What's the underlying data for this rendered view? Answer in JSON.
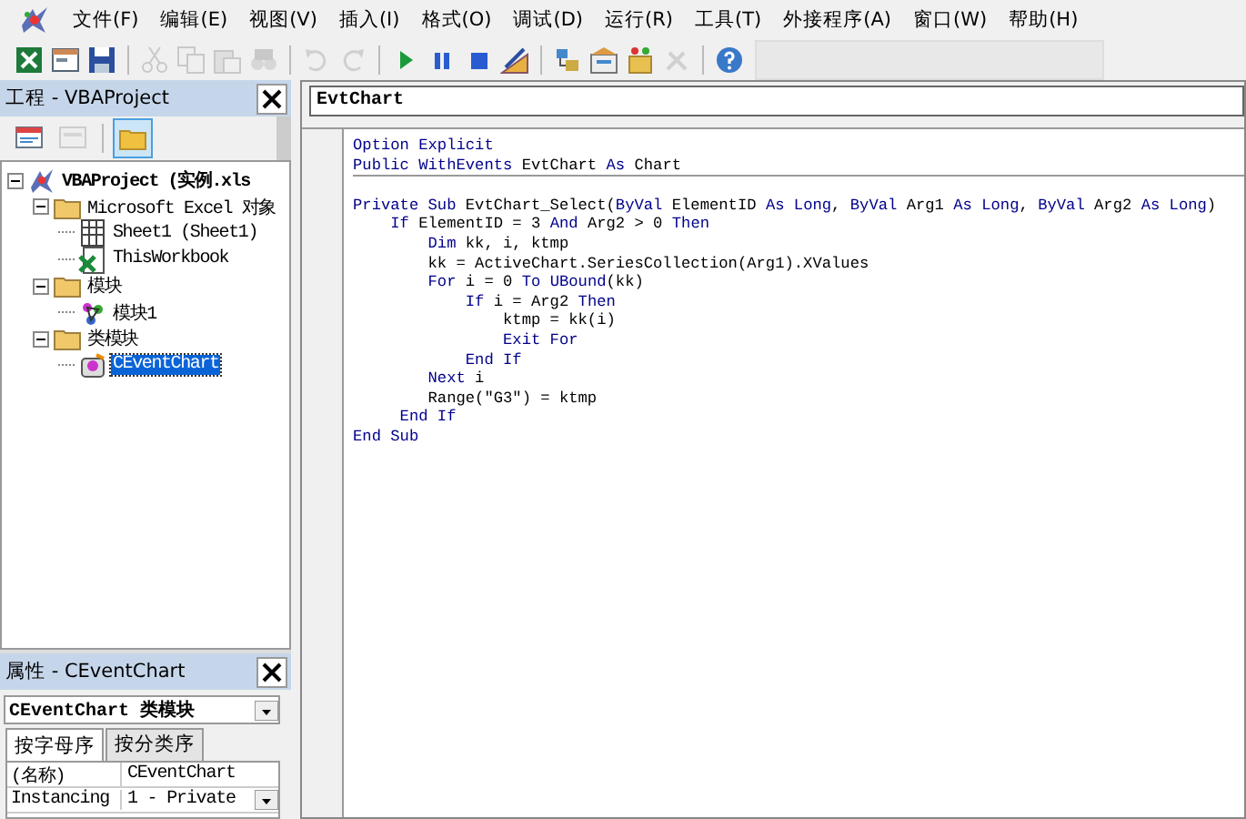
{
  "menu": [
    {
      "label": "文件(F)"
    },
    {
      "label": "编辑(E)"
    },
    {
      "label": "视图(V)"
    },
    {
      "label": "插入(I)"
    },
    {
      "label": "格式(O)"
    },
    {
      "label": "调试(D)"
    },
    {
      "label": "运行(R)"
    },
    {
      "label": "工具(T)"
    },
    {
      "label": "外接程序(A)"
    },
    {
      "label": "窗口(W)"
    },
    {
      "label": "帮助(H)"
    }
  ],
  "toolbar": [
    {
      "kind": "excel",
      "disabled": false
    },
    {
      "kind": "insert",
      "disabled": false
    },
    {
      "kind": "save",
      "disabled": false
    },
    {
      "kind": "sep"
    },
    {
      "kind": "cut",
      "disabled": true
    },
    {
      "kind": "copy",
      "disabled": true
    },
    {
      "kind": "paste",
      "disabled": true
    },
    {
      "kind": "find",
      "disabled": true
    },
    {
      "kind": "sep"
    },
    {
      "kind": "undo",
      "disabled": true
    },
    {
      "kind": "redo",
      "disabled": true
    },
    {
      "kind": "sep"
    },
    {
      "kind": "run",
      "disabled": false
    },
    {
      "kind": "pause",
      "disabled": false
    },
    {
      "kind": "stop",
      "disabled": false
    },
    {
      "kind": "design",
      "disabled": false
    },
    {
      "kind": "sep"
    },
    {
      "kind": "project",
      "disabled": false
    },
    {
      "kind": "properties",
      "disabled": false
    },
    {
      "kind": "browser",
      "disabled": false
    },
    {
      "kind": "toolbox",
      "disabled": true
    },
    {
      "kind": "sep"
    },
    {
      "kind": "help",
      "disabled": false
    }
  ],
  "project_pane": {
    "title": "工程 - VBAProject",
    "tools": [
      {
        "kind": "code",
        "disabled": false,
        "selected": false
      },
      {
        "kind": "object",
        "disabled": true,
        "selected": false
      },
      {
        "kind": "folders",
        "disabled": false,
        "selected": true
      }
    ],
    "tree": [
      {
        "label": "VBAProject (实例.xls",
        "kind": "project",
        "expanded": true,
        "selected": false,
        "children": [
          {
            "label": "Microsoft Excel 对象",
            "kind": "folder",
            "expanded": true,
            "selected": false,
            "children": [
              {
                "label": "Sheet1 (Sheet1)",
                "kind": "sheet",
                "selected": false
              },
              {
                "label": "ThisWorkbook",
                "kind": "workbook",
                "selected": false
              }
            ]
          },
          {
            "label": "模块",
            "kind": "folder",
            "expanded": true,
            "selected": false,
            "children": [
              {
                "label": "模块1",
                "kind": "module",
                "selected": false
              }
            ]
          },
          {
            "label": "类模块",
            "kind": "folder",
            "expanded": true,
            "selected": false,
            "children": [
              {
                "label": "CEventChart",
                "kind": "class",
                "selected": true
              }
            ]
          }
        ]
      }
    ]
  },
  "properties_pane": {
    "title": "属性 - CEventChart",
    "object": "CEventChart 类模块",
    "tabs": [
      {
        "label": "按字母序",
        "selected": true
      },
      {
        "label": "按分类序",
        "selected": false
      }
    ],
    "rows": [
      {
        "name": "(名称)",
        "value": "CEventChart",
        "dropdown": false
      },
      {
        "name": "Instancing",
        "value": "1 - Private",
        "dropdown": true
      }
    ]
  },
  "code_window": {
    "object": "EvtChart",
    "sections": [
      {
        "lines": [
          [
            {
              "text": "Option Explicit",
              "kind": "keyword"
            }
          ],
          [
            {
              "text": "Public WithEvents",
              "kind": "keyword"
            },
            {
              "text": " EvtChart ",
              "kind": "plain"
            },
            {
              "text": "As",
              "kind": "keyword"
            },
            {
              "text": " Chart",
              "kind": "plain"
            }
          ]
        ]
      },
      {
        "lines": [
          [
            {
              "text": "Private Sub",
              "kind": "keyword"
            },
            {
              "text": " EvtChart_Select(",
              "kind": "plain"
            },
            {
              "text": "ByVal",
              "kind": "keyword"
            },
            {
              "text": " ElementID ",
              "kind": "plain"
            },
            {
              "text": "As Long",
              "kind": "keyword"
            },
            {
              "text": ", ",
              "kind": "plain"
            },
            {
              "text": "ByVal",
              "kind": "keyword"
            },
            {
              "text": " Arg1 ",
              "kind": "plain"
            },
            {
              "text": "As Long",
              "kind": "keyword"
            },
            {
              "text": ", ",
              "kind": "plain"
            },
            {
              "text": "ByVal",
              "kind": "keyword"
            },
            {
              "text": " Arg2 ",
              "kind": "plain"
            },
            {
              "text": "As Long",
              "kind": "keyword"
            },
            {
              "text": ")",
              "kind": "plain"
            }
          ],
          [
            {
              "text": "    If",
              "kind": "keyword"
            },
            {
              "text": " ElementID = 3 ",
              "kind": "plain"
            },
            {
              "text": "And",
              "kind": "keyword"
            },
            {
              "text": " Arg2 > 0 ",
              "kind": "plain"
            },
            {
              "text": "Then",
              "kind": "keyword"
            }
          ],
          [
            {
              "text": "        Dim",
              "kind": "keyword"
            },
            {
              "text": " kk, i, ktmp",
              "kind": "plain"
            }
          ],
          [
            {
              "text": "        kk = ActiveChart.SeriesCollection(Arg1).XValues",
              "kind": "plain"
            }
          ],
          [
            {
              "text": "        For",
              "kind": "keyword"
            },
            {
              "text": " i = 0 ",
              "kind": "plain"
            },
            {
              "text": "To UBound",
              "kind": "keyword"
            },
            {
              "text": "(kk)",
              "kind": "plain"
            }
          ],
          [
            {
              "text": "            If",
              "kind": "keyword"
            },
            {
              "text": " i = Arg2 ",
              "kind": "plain"
            },
            {
              "text": "Then",
              "kind": "keyword"
            }
          ],
          [
            {
              "text": "                ktmp = kk(i)",
              "kind": "plain"
            }
          ],
          [
            {
              "text": "                Exit For",
              "kind": "keyword"
            }
          ],
          [
            {
              "text": "            End If",
              "kind": "keyword"
            }
          ],
          [
            {
              "text": "        Next",
              "kind": "keyword"
            },
            {
              "text": " i",
              "kind": "plain"
            }
          ],
          [
            {
              "text": "        Range(\"G3\") = ktmp",
              "kind": "plain"
            }
          ],
          [
            {
              "text": "     End If",
              "kind": "keyword"
            }
          ],
          [
            {
              "text": "End Sub",
              "kind": "keyword"
            }
          ]
        ]
      }
    ]
  }
}
